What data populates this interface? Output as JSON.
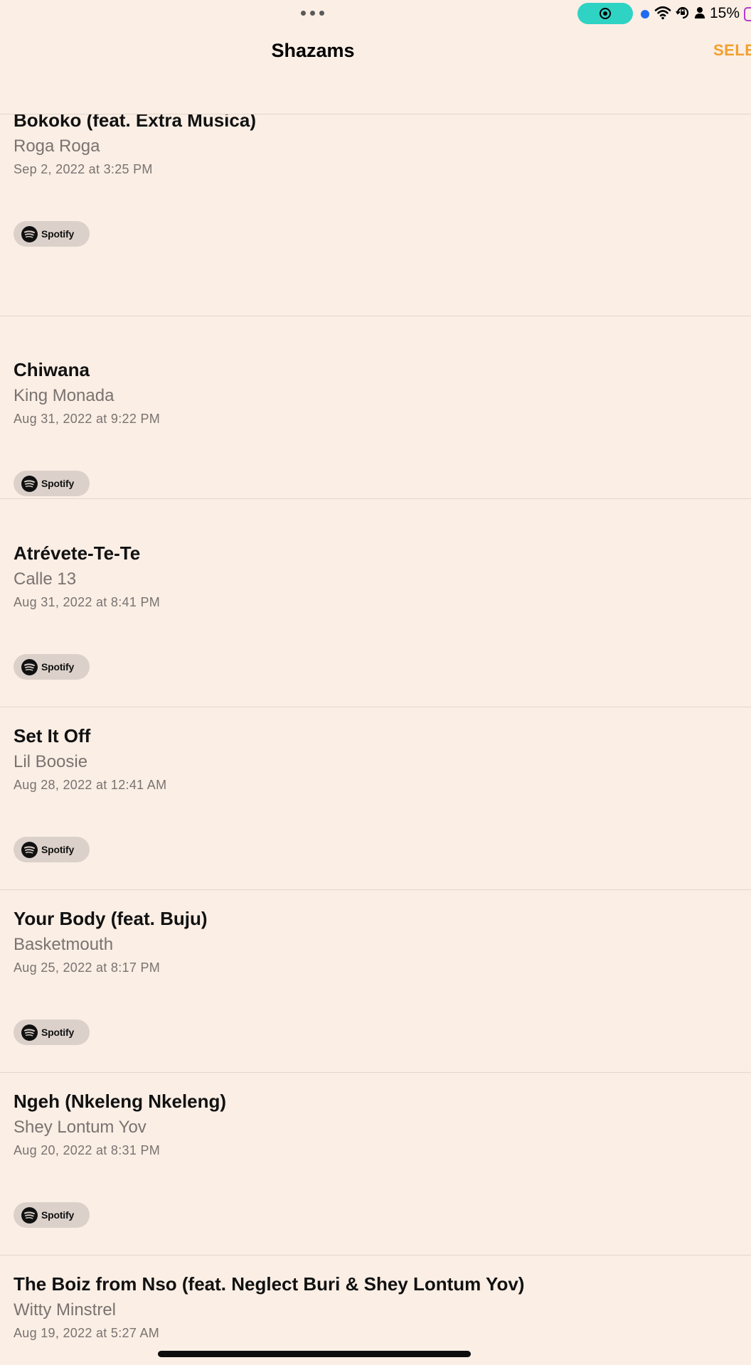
{
  "status_bar": {
    "battery_percent": "15%",
    "icons": [
      "more-dots-icon",
      "screen-record-icon",
      "dot-icon",
      "wifi-icon",
      "orientation-lock-icon",
      "person-icon",
      "battery-icon"
    ],
    "record_pill_color": "#2FD3C4",
    "battery_color": "#B43BD0"
  },
  "nav": {
    "title": "Shazams",
    "select_label": "SELE"
  },
  "colors": {
    "background": "#FAEEE5",
    "accent": "#F2A02D",
    "secondary_text": "#7A7370",
    "pill_bg": "#DCD1CA"
  },
  "items": [
    {
      "title": "Bokoko (feat. Extra Musica)",
      "artist": "Roga Roga",
      "date": "Sep 2, 2022 at 3:25 PM",
      "button_label": "Spotify"
    },
    {
      "title": "Chiwana",
      "artist": "King Monada",
      "date": "Aug 31, 2022 at 9:22 PM",
      "button_label": "Spotify"
    },
    {
      "title": "Atrévete-Te-Te",
      "artist": "Calle 13",
      "date": "Aug 31, 2022 at 8:41 PM",
      "button_label": "Spotify"
    },
    {
      "title": "Set It Off",
      "artist": "Lil Boosie",
      "date": "Aug 28, 2022 at 12:41 AM",
      "button_label": "Spotify"
    },
    {
      "title": "Your Body (feat. Buju)",
      "artist": "Basketmouth",
      "date": "Aug 25, 2022 at 8:17 PM",
      "button_label": "Spotify"
    },
    {
      "title": "Ngeh (Nkeleng Nkeleng)",
      "artist": "Shey Lontum Yov",
      "date": "Aug 20, 2022 at 8:31 PM",
      "button_label": "Spotify"
    },
    {
      "title": "The Boiz from Nso (feat. Neglect Buri & Shey Lontum Yov)",
      "artist": "Witty Minstrel",
      "date": "Aug 19, 2022 at 5:27 AM",
      "button_label": "Spotify"
    }
  ]
}
